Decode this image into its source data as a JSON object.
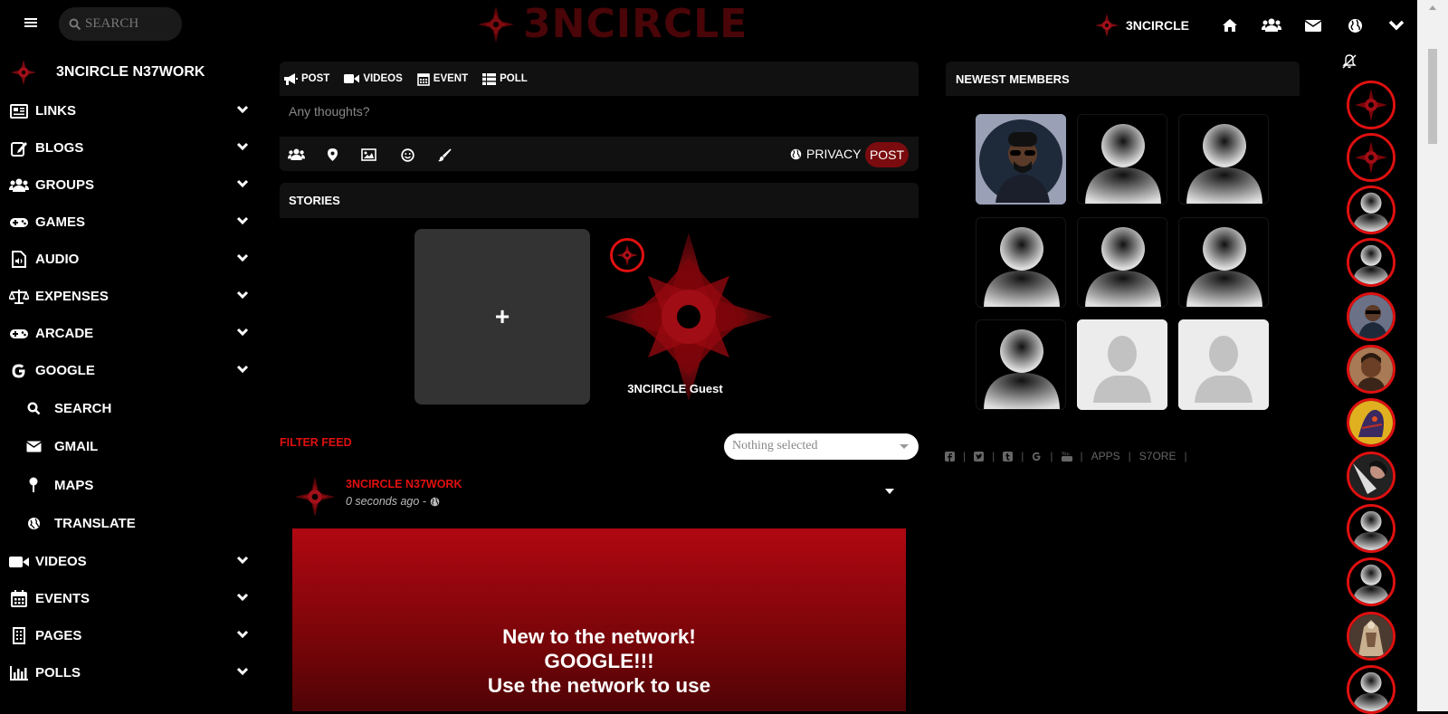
{
  "topbar": {
    "search_placeholder": "SEARCH",
    "logo_text": "3NCIRCLE",
    "brand_label": "3NCIRCLE",
    "icons": [
      "home-icon",
      "users-icon",
      "envelope-icon",
      "globe-icon",
      "chevron-down-icon"
    ]
  },
  "sidebar": {
    "header": "3NCIRCLE N37WORK",
    "items": [
      {
        "label": "LINKS",
        "icon": "newspaper-icon"
      },
      {
        "label": "BLOGS",
        "icon": "edit-icon"
      },
      {
        "label": "GROUPS",
        "icon": "users-icon"
      },
      {
        "label": "GAMES",
        "icon": "gamepad-icon"
      },
      {
        "label": "AUDIO",
        "icon": "audio-file-icon"
      },
      {
        "label": "EXPENSES",
        "icon": "balance-scale-icon"
      },
      {
        "label": "ARCADE",
        "icon": "gamepad-icon"
      },
      {
        "label": "GOOGLE",
        "icon": "google-icon"
      }
    ],
    "google_sub": [
      {
        "label": "SEARCH",
        "icon": "search-icon"
      },
      {
        "label": "GMAIL",
        "icon": "envelope-icon"
      },
      {
        "label": "MAPS",
        "icon": "map-pin-icon"
      },
      {
        "label": "TRANSLATE",
        "icon": "translate-icon"
      }
    ],
    "items2": [
      {
        "label": "VIDEOS",
        "icon": "video-icon"
      },
      {
        "label": "EVENTS",
        "icon": "calendar-icon"
      },
      {
        "label": "PAGES",
        "icon": "building-icon"
      },
      {
        "label": "POLLS",
        "icon": "bar-chart-icon"
      }
    ]
  },
  "composer": {
    "tabs": [
      {
        "label": "POST",
        "icon": "bullhorn-icon"
      },
      {
        "label": "VIDEOS",
        "icon": "video-icon"
      },
      {
        "label": "EVENT",
        "icon": "calendar-icon"
      },
      {
        "label": "POLL",
        "icon": "list-icon"
      }
    ],
    "placeholder": "Any thoughts?",
    "privacy_label": "PRIVACY",
    "post_label": "POST"
  },
  "stories": {
    "title": "STORIES",
    "add_symbol": "+",
    "story_name": "3NCIRCLE Guest"
  },
  "feed": {
    "filter_label": "FILTER FEED",
    "filter_value": "Nothing selected",
    "post": {
      "author": "3NCIRCLE N37WORK",
      "time": "0 seconds ago -",
      "banner_lines": [
        "New to the network!",
        "GOOGLE!!!",
        "Use the network to use"
      ]
    }
  },
  "newest_members": {
    "title": "NEWEST MEMBERS",
    "members": [
      "photo",
      "default",
      "default",
      "default",
      "default",
      "default",
      "default",
      "placeholder",
      "placeholder"
    ]
  },
  "footer": {
    "links": [
      "APPS",
      "S7ORE"
    ],
    "social_icons": [
      "facebook-icon",
      "twitter-icon",
      "tumblr-icon",
      "google-icon",
      "youtube-icon"
    ],
    "separator": "|"
  },
  "colors": {
    "accent_red": "#e01010",
    "dark_red": "#7a0b0f",
    "panel": "#111111",
    "background": "#000000"
  }
}
